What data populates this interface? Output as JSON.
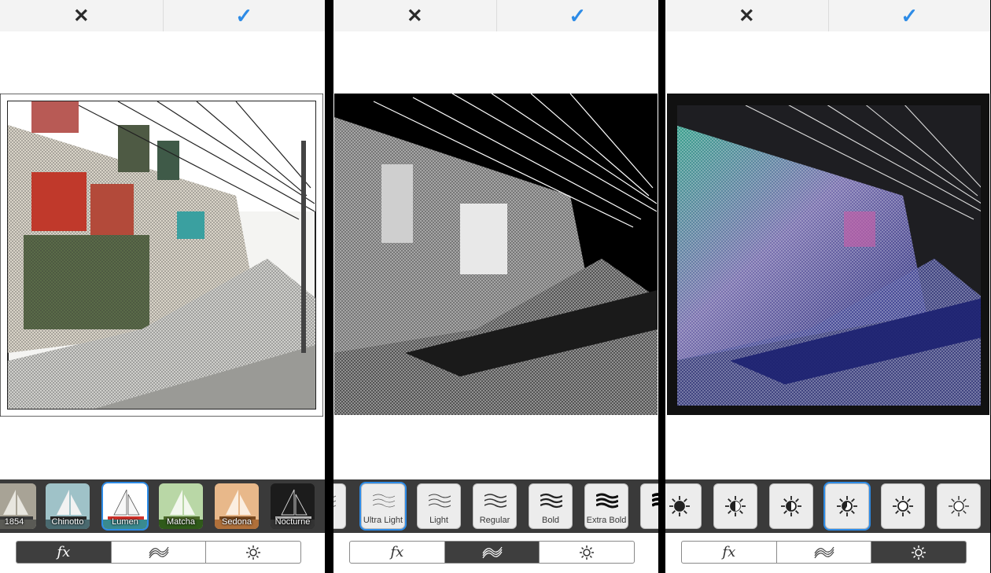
{
  "panels": [
    {
      "cancel_icon": "close-icon",
      "confirm_icon": "checkmark-icon",
      "filters": [
        {
          "label": "1854"
        },
        {
          "label": "Chinotto"
        },
        {
          "label": "Lumen",
          "selected": true
        },
        {
          "label": "Matcha"
        },
        {
          "label": "Sedona"
        },
        {
          "label": "Nocturne"
        }
      ],
      "active_tab": "fx"
    },
    {
      "strokes": [
        {
          "label": "Ultra Light",
          "selected": true
        },
        {
          "label": "Light"
        },
        {
          "label": "Regular"
        },
        {
          "label": "Bold"
        },
        {
          "label": "Extra Bold"
        }
      ],
      "active_tab": "stroke"
    },
    {
      "brightness_levels": 7,
      "selected_level_index": 3,
      "active_tab": "brightness"
    }
  ],
  "tabs": {
    "fx_label": "fx",
    "stroke_icon": "stroke-waves-icon",
    "brightness_icon": "sun-icon"
  },
  "colors": {
    "accent": "#2d8be6",
    "toolbar": "#3a3a3a",
    "segment_active": "#3e3e3e"
  }
}
